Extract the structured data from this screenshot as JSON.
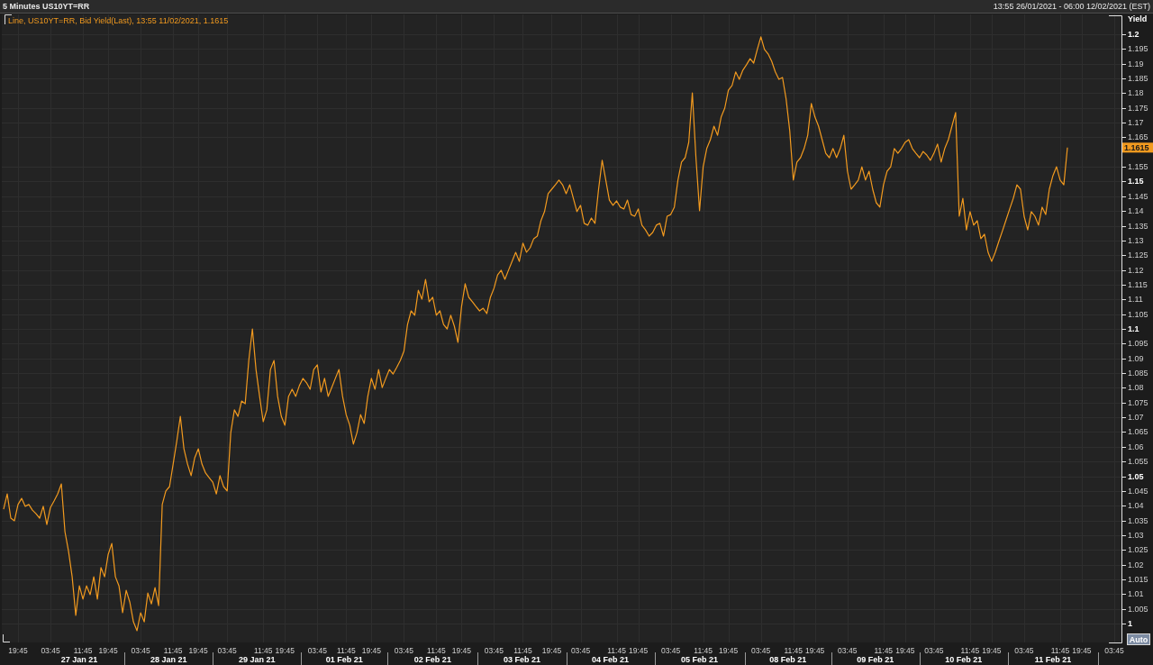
{
  "window": {
    "title": "5 Minutes US10YT=RR",
    "range": "13:55 26/01/2021 - 06:00 12/02/2021 (EST)"
  },
  "chart": {
    "legend": "Line, US10YT=RR, Bid Yield(Last), 13:55 11/02/2021, 1.1615",
    "last_value_label": "1.1615",
    "auto_button": "Auto",
    "chart_data": {
      "type": "line",
      "ylabel": "Yield",
      "grid": true,
      "ylim": [
        0.9936,
        1.2067
      ],
      "annotations": [
        "27 Jan 21",
        "28 Jan 21",
        "29 Jan 21",
        "01 Feb 21",
        "02 Feb 21",
        "03 Feb 21",
        "04 Feb 21",
        "05 Feb 21",
        "08 Feb 21",
        "09 Feb 21",
        "10 Feb 21",
        "11 Feb 21"
      ],
      "yticks": [
        1,
        1.005,
        1.01,
        1.015,
        1.02,
        1.025,
        1.03,
        1.035,
        1.04,
        1.045,
        1.05,
        1.055,
        1.06,
        1.065,
        1.07,
        1.075,
        1.08,
        1.085,
        1.09,
        1.095,
        1.1,
        1.105,
        1.11,
        1.115,
        1.12,
        1.125,
        1.13,
        1.135,
        1.14,
        1.145,
        1.15,
        1.155,
        1.165,
        1.17,
        1.175,
        1.18,
        1.185,
        1.19,
        1.195,
        1.2
      ],
      "categories": [
        null,
        null,
        null,
        null,
        "19:45",
        null,
        null,
        null,
        null,
        null,
        null,
        null,
        null,
        "03:45",
        null,
        null,
        null,
        null,
        null,
        null,
        null,
        null,
        "11:45",
        null,
        null,
        null,
        null,
        null,
        null,
        "19:45",
        null,
        null,
        null,
        null,
        null,
        null,
        null,
        null,
        "03:45",
        null,
        null,
        null,
        null,
        null,
        null,
        null,
        null,
        "11:45",
        null,
        null,
        null,
        null,
        null,
        null,
        "19:45",
        null,
        null,
        null,
        null,
        null,
        null,
        null,
        "03:45",
        null,
        null,
        null,
        null,
        null,
        null,
        null,
        null,
        null,
        "11:45",
        null,
        null,
        null,
        null,
        null,
        "19:45",
        null,
        null,
        null,
        null,
        null,
        null,
        null,
        null,
        "03:45",
        null,
        null,
        null,
        null,
        null,
        null,
        null,
        "11:45",
        null,
        null,
        null,
        null,
        null,
        null,
        "19:45",
        null,
        null,
        null,
        null,
        null,
        null,
        null,
        null,
        "03:45",
        null,
        null,
        null,
        null,
        null,
        null,
        null,
        null,
        "11:45",
        null,
        null,
        null,
        null,
        null,
        null,
        "19:45",
        null,
        null,
        null,
        null,
        null,
        null,
        null,
        null,
        "03:45",
        null,
        null,
        null,
        null,
        null,
        null,
        null,
        "11:45",
        null,
        null,
        null,
        null,
        null,
        null,
        null,
        "19:45",
        null,
        null,
        null,
        null,
        null,
        null,
        null,
        "03:45",
        null,
        null,
        null,
        null,
        null,
        null,
        null,
        null,
        null,
        "11:45",
        null,
        null,
        null,
        null,
        null,
        "19:45",
        null,
        null,
        null,
        null,
        null,
        null,
        null,
        null,
        "03:45",
        null,
        null,
        null,
        null,
        null,
        null,
        null,
        null,
        "11:45",
        null,
        null,
        null,
        null,
        null,
        null,
        "19:45",
        null,
        null,
        null,
        null,
        null,
        null,
        null,
        null,
        "03:45",
        null,
        null,
        null,
        null,
        null,
        null,
        null,
        null,
        "11:45",
        null,
        null,
        null,
        null,
        null,
        "19:45",
        null,
        null,
        null,
        null,
        null,
        null,
        null,
        null,
        "03:45",
        null,
        null,
        null,
        null,
        null,
        null,
        null,
        null,
        null,
        "11:45",
        null,
        null,
        null,
        null,
        null,
        "19:45",
        null,
        null,
        null,
        null,
        null,
        null,
        null,
        "03:45",
        null,
        null,
        null,
        null,
        null,
        null,
        null,
        null,
        null,
        "11:45",
        null,
        null,
        null,
        null,
        null,
        "19:45",
        null,
        null,
        null,
        null,
        null,
        null,
        null,
        null,
        "03:45",
        null,
        null,
        null,
        null,
        null,
        null,
        null,
        null,
        null,
        "11:45",
        null,
        null,
        null,
        null,
        null,
        "19:45",
        null,
        null,
        null,
        null,
        null,
        null,
        null,
        null,
        "03:45",
        null
      ],
      "series": [
        {
          "color": "#f29a1f",
          "values": [
            1.0388,
            1.044,
            1.0358,
            1.0349,
            1.0404,
            1.0425,
            1.0398,
            1.0404,
            1.0385,
            1.0373,
            1.0358,
            1.0398,
            1.0336,
            1.0394,
            1.0416,
            1.044,
            1.0474,
            1.0312,
            1.0245,
            1.0159,
            1.0028,
            1.0128,
            1.0083,
            1.0128,
            1.0098,
            1.0159,
            1.0083,
            1.019,
            1.0159,
            1.0235,
            1.0272,
            1.0159,
            1.0128,
            1.0037,
            1.0113,
            1.0073,
            1.0006,
            0.9976,
            1.0037,
            1.0006,
            1.0104,
            1.0067,
            1.0122,
            1.0061,
            1.0404,
            1.045,
            1.0465,
            1.0541,
            1.0618,
            1.0703,
            1.0593,
            1.0541,
            1.0502,
            1.0563,
            1.0593,
            1.0541,
            1.0511,
            1.0495,
            1.048,
            1.044,
            1.0502,
            1.0465,
            1.045,
            1.0648,
            1.0725,
            1.0703,
            1.0755,
            1.0746,
            1.0893,
            1.1,
            1.0862,
            1.0771,
            1.0685,
            1.0725,
            1.0862,
            1.0893,
            1.0771,
            1.0703,
            1.0673,
            1.0771,
            1.0795,
            1.0771,
            1.0807,
            1.0832,
            1.0817,
            1.0795,
            1.0862,
            1.0878,
            1.0786,
            1.0832,
            1.0771,
            1.0801,
            1.0832,
            1.0862,
            1.0771,
            1.0709,
            1.0673,
            1.0609,
            1.0648,
            1.0709,
            1.0679,
            1.0771,
            1.0832,
            1.0795,
            1.0862,
            1.0801,
            1.0832,
            1.0862,
            1.0847,
            1.0869,
            1.0893,
            1.0924,
            1.1015,
            1.1061,
            1.1046,
            1.1131,
            1.1101,
            1.1168,
            1.1092,
            1.1107,
            1.1046,
            1.1061,
            1.1015,
            1.1,
            1.1046,
            1.1009,
            1.0954,
            1.1076,
            1.1153,
            1.1107,
            1.1092,
            1.1076,
            1.1061,
            1.107,
            1.1052,
            1.1107,
            1.1138,
            1.1183,
            1.1199,
            1.1168,
            1.1199,
            1.1229,
            1.126,
            1.1229,
            1.1291,
            1.126,
            1.1275,
            1.1306,
            1.1315,
            1.1367,
            1.1398,
            1.1459,
            1.1474,
            1.1489,
            1.1505,
            1.1489,
            1.1459,
            1.1489,
            1.1443,
            1.1398,
            1.1419,
            1.1358,
            1.1352,
            1.1376,
            1.1358,
            1.1474,
            1.1572,
            1.1505,
            1.1437,
            1.1419,
            1.1434,
            1.1413,
            1.1407,
            1.1437,
            1.1388,
            1.1382,
            1.1407,
            1.1352,
            1.1336,
            1.1315,
            1.1327,
            1.1352,
            1.1358,
            1.1315,
            1.1382,
            1.1388,
            1.1413,
            1.1505,
            1.1566,
            1.1581,
            1.1633,
            1.1801,
            1.1581,
            1.1401,
            1.155,
            1.1612,
            1.1642,
            1.1688,
            1.1657,
            1.1719,
            1.1749,
            1.181,
            1.1826,
            1.1872,
            1.1847,
            1.1878,
            1.1896,
            1.1917,
            1.1902,
            1.1948,
            1.1991,
            1.1948,
            1.1933,
            1.1908,
            1.1872,
            1.1847,
            1.1853,
            1.178,
            1.1673,
            1.1505,
            1.1566,
            1.1581,
            1.1612,
            1.1657,
            1.1765,
            1.1719,
            1.1688,
            1.1642,
            1.1596,
            1.1581,
            1.1612,
            1.1581,
            1.1612,
            1.1657,
            1.1535,
            1.1474,
            1.1489,
            1.1505,
            1.155,
            1.1505,
            1.1535,
            1.1474,
            1.1428,
            1.1413,
            1.1489,
            1.1535,
            1.155,
            1.1612,
            1.1596,
            1.1612,
            1.1633,
            1.1642,
            1.1612,
            1.1596,
            1.1581,
            1.1602,
            1.159,
            1.1572,
            1.1596,
            1.1627,
            1.1566,
            1.1612,
            1.1642,
            1.1688,
            1.1734,
            1.1382,
            1.1443,
            1.1336,
            1.1398,
            1.1352,
            1.1367,
            1.1306,
            1.1321,
            1.126,
            1.1229,
            1.126,
            1.1297,
            1.1333,
            1.137,
            1.1407,
            1.1443,
            1.1489,
            1.1474,
            1.1382,
            1.1336,
            1.1398,
            1.1382,
            1.1352,
            1.1413,
            1.1388,
            1.1474,
            1.152,
            1.155,
            1.1505,
            1.1489,
            1.1615,
            null,
            null,
            null,
            null,
            null,
            null,
            null,
            null,
            null,
            null,
            null,
            null,
            null,
            null
          ]
        }
      ]
    }
  }
}
